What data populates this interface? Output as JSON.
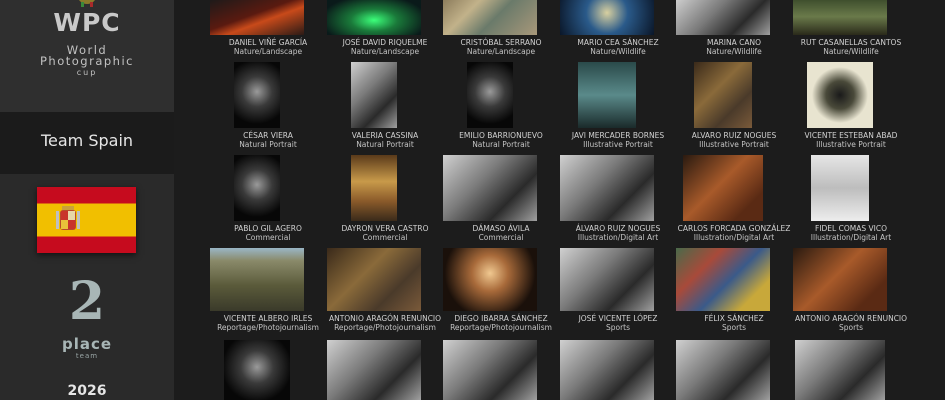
{
  "sidebar": {
    "logo": {
      "wpc": "WPC",
      "line1": "World",
      "line2": "Photographic",
      "line3": "cup"
    },
    "team_name": "Team Spain",
    "place_number": "2",
    "place_label": "place",
    "place_sub": "team",
    "year": "2026",
    "flag": {
      "country": "Spain",
      "red": "#c60b1e",
      "yellow": "#f1bf00"
    }
  },
  "gallery": {
    "rows": [
      [
        {
          "author": "DANIEL VIÑÉ GARCÍA",
          "category": "Nature/Landscape",
          "tone": "volcano"
        },
        {
          "author": "JOSÉ DAVID RIQUELME",
          "category": "Nature/Landscape",
          "tone": "aurora"
        },
        {
          "author": "CRISTÓBAL SERRANO",
          "category": "Nature/Landscape",
          "tone": "aerial"
        },
        {
          "author": "MARIO CEA SÁNCHEZ",
          "category": "Nature/Wildlife",
          "tone": "bluewater"
        },
        {
          "author": "MARINA CANO",
          "category": "Nature/Wildlife",
          "tone": "mono"
        },
        {
          "author": "RUT CASANELLAS CANTOS",
          "category": "Nature/Wildlife",
          "tone": "green"
        }
      ],
      [
        {
          "author": "CÉSAR VIERA",
          "category": "Natural Portrait",
          "tone": "darkportrait"
        },
        {
          "author": "VALERIA CASSINA",
          "category": "Natural Portrait",
          "tone": "mono"
        },
        {
          "author": "EMILIO BARRIONUEVO",
          "category": "Natural Portrait",
          "tone": "darkportrait"
        },
        {
          "author": "JAVI MERCADER BORNES",
          "category": "Illustrative Portrait",
          "tone": "teal"
        },
        {
          "author": "ALVARO RUIZ NOGUES",
          "category": "Illustrative Portrait",
          "tone": "warm"
        },
        {
          "author": "VICENTE ESTEBAN ABAD",
          "category": "Illustrative Portrait",
          "tone": "cream"
        }
      ],
      [
        {
          "author": "PABLO GIL AGERO",
          "category": "Commercial",
          "tone": "darkportrait"
        },
        {
          "author": "DAYRON VERA CASTRO",
          "category": "Commercial",
          "tone": "gold"
        },
        {
          "author": "DÁMASO ÁVILA",
          "category": "Commercial",
          "tone": "mono"
        },
        {
          "author": "ÁLVARO RUIZ NOGUES",
          "category": "Illustration/Digital Art",
          "tone": "mono"
        },
        {
          "author": "CARLOS FORCADA GONZÁLEZ",
          "category": "Illustration/Digital Art",
          "tone": "copper"
        },
        {
          "author": "FIDEL COMAS VICO",
          "category": "Illustration/Digital Art",
          "tone": "light"
        }
      ],
      [
        {
          "author": "VICENTE ALBERO IRLES",
          "category": "Reportage/Photojournalism",
          "tone": "crowd"
        },
        {
          "author": "ANTONIO ARAGÓN RENUNCIO",
          "category": "Reportage/Photojournalism",
          "tone": "warm"
        },
        {
          "author": "DIEGO IBARRA SÁNCHEZ",
          "category": "Reportage/Photojournalism",
          "tone": "fire"
        },
        {
          "author": "JOSÉ VICENTE LÓPEZ",
          "category": "Sports",
          "tone": "mono"
        },
        {
          "author": "FÉLIX SÁNCHEZ",
          "category": "Sports",
          "tone": "crowdcolor"
        },
        {
          "author": "ANTONIO ARAGÓN RENUNCIO",
          "category": "Sports",
          "tone": "copper"
        }
      ],
      [
        {
          "author": "",
          "category": "",
          "tone": "darkportrait"
        },
        {
          "author": "",
          "category": "",
          "tone": "mono"
        },
        {
          "author": "",
          "category": "",
          "tone": "mono"
        },
        {
          "author": "",
          "category": "",
          "tone": "mono"
        },
        {
          "author": "",
          "category": "",
          "tone": "mono"
        },
        {
          "author": "",
          "category": "",
          "tone": "mono"
        }
      ]
    ]
  }
}
